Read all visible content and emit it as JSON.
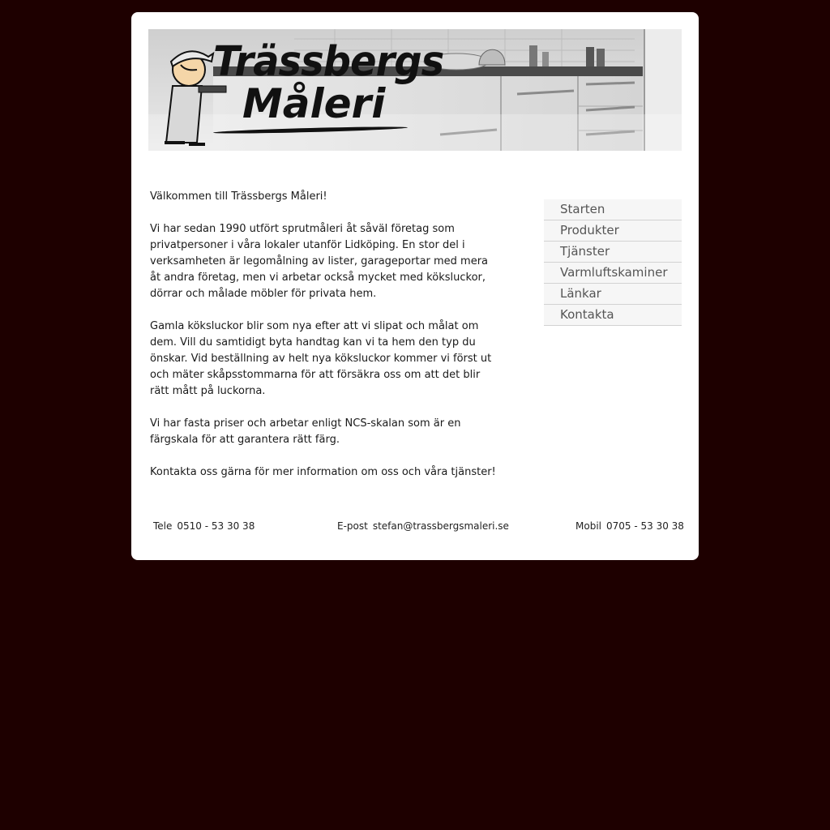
{
  "logo": {
    "line1": "Trässbergs",
    "line2": "Måleri"
  },
  "content": {
    "paragraphs": [
      "Välkommen till Trässbergs Måleri!",
      "Vi har sedan 1990 utfört sprutmåleri åt såväl företag som privatpersoner i våra lokaler utanför Lidköping. En stor del i verksamheten är legomålning av lister, garageportar med mera åt andra företag, men vi arbetar också mycket med köksluckor, dörrar och målade möbler för privata hem.",
      "Gamla köksluckor blir som nya efter att vi slipat och målat om dem. Vill du samtidigt byta handtag kan vi ta hem den typ du önskar. Vid beställning av helt nya köksluckor kommer vi först ut och mäter skåpsstommarna för att försäkra oss om att det blir rätt mått på luckorna.",
      "Vi har fasta priser och arbetar enligt NCS-skalan som är en färgskala för att garantera rätt färg.",
      "Kontakta oss gärna för mer information om oss och våra tjänster!"
    ]
  },
  "nav": {
    "items": [
      {
        "label": "Starten"
      },
      {
        "label": "Produkter"
      },
      {
        "label": "Tjänster"
      },
      {
        "label": "Varmluftskaminer"
      },
      {
        "label": "Länkar"
      },
      {
        "label": "Kontakta"
      }
    ]
  },
  "footer": {
    "phone_label": "Tele",
    "phone": "0510 - 53 30 38",
    "email_label": "E-post",
    "email": "stefan@trassbergsmaleri.se",
    "mobile_label": "Mobil",
    "mobile": "0705 - 53 30 38"
  },
  "colors": {
    "page_background": "#1e0000",
    "card_background": "#ffffff",
    "nav_text": "#555555"
  }
}
